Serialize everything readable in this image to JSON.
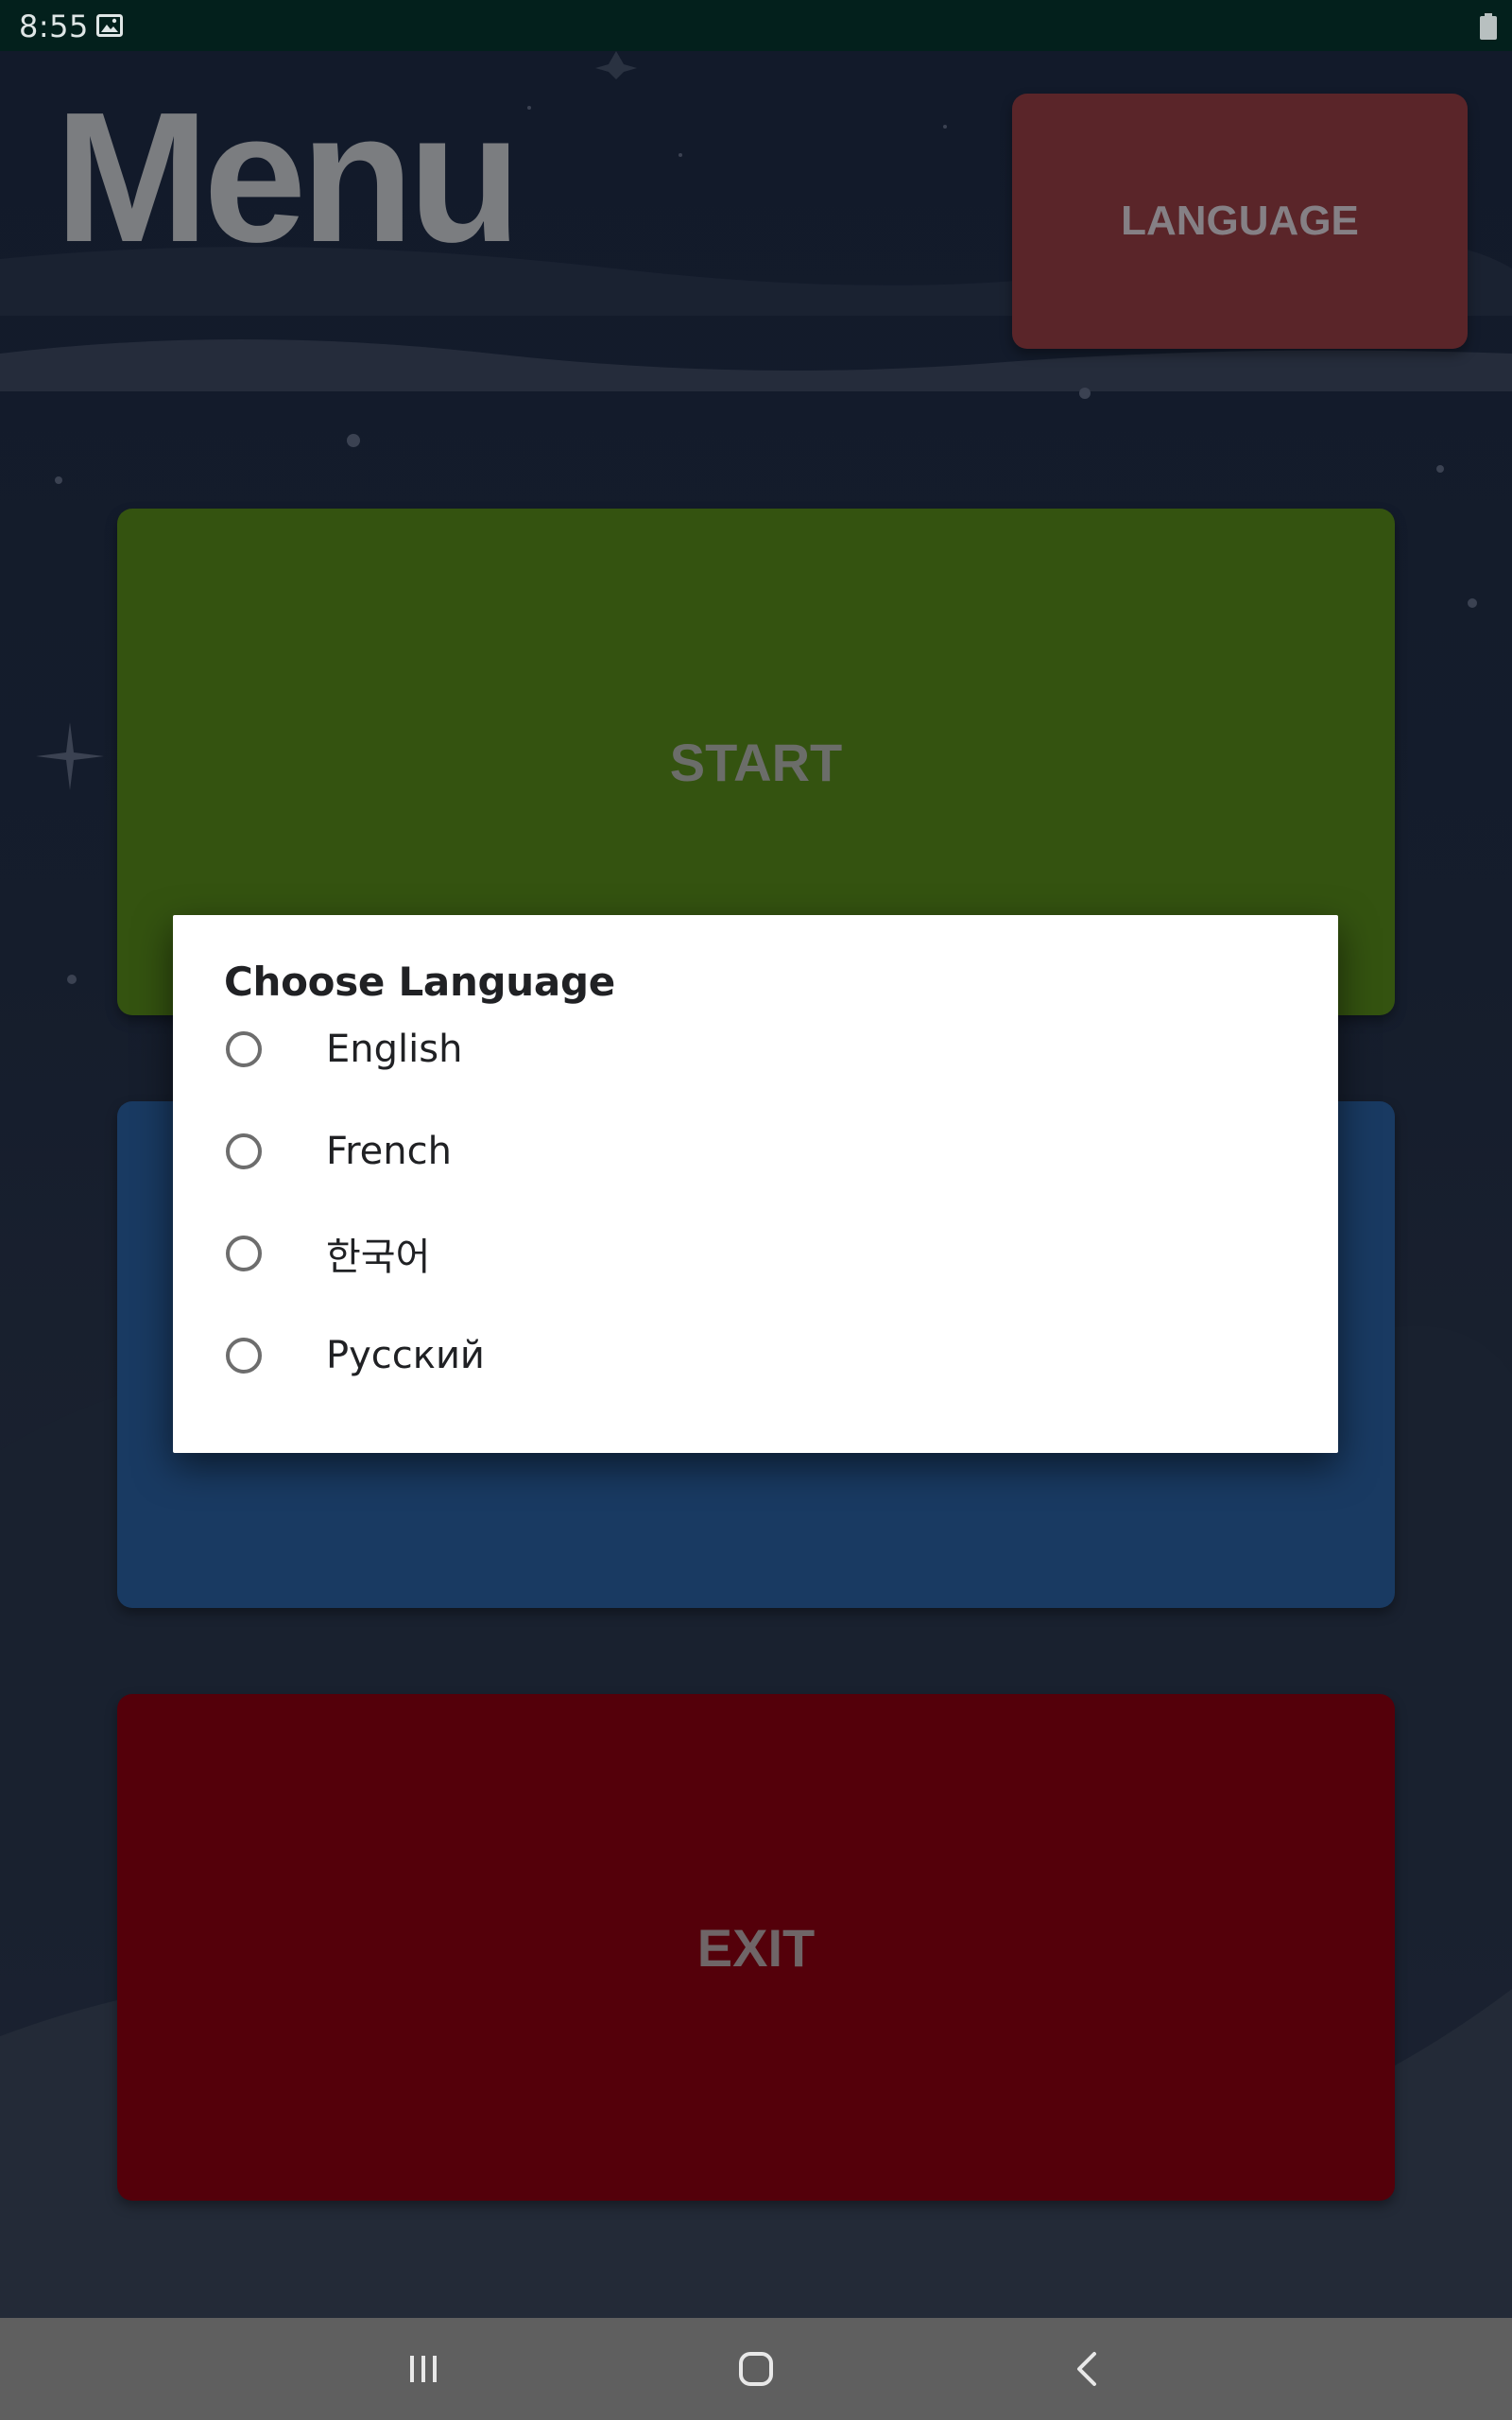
{
  "status_bar": {
    "time": "8:55",
    "icons": [
      "image-icon",
      "battery-icon"
    ]
  },
  "menu": {
    "title": "Menu",
    "language_button": "LANGUAGE",
    "start_button": "START",
    "middle_button": "",
    "exit_button": "EXIT"
  },
  "dialog": {
    "title": "Choose Language",
    "options": [
      {
        "label": "English",
        "selected": false
      },
      {
        "label": "French",
        "selected": false
      },
      {
        "label": "한국어",
        "selected": false
      },
      {
        "label": "Русский",
        "selected": false
      }
    ]
  },
  "nav_bar": {
    "icons": [
      "recent-apps-icon",
      "home-icon",
      "back-icon"
    ]
  },
  "colors": {
    "language_button": "#5a2529",
    "start_button": "#345310",
    "middle_button": "#193a62",
    "exit_button": "#54000a",
    "dialog_background": "#ffffff",
    "status_bar": "#03201c",
    "nav_bar": "#5f5f5f"
  }
}
